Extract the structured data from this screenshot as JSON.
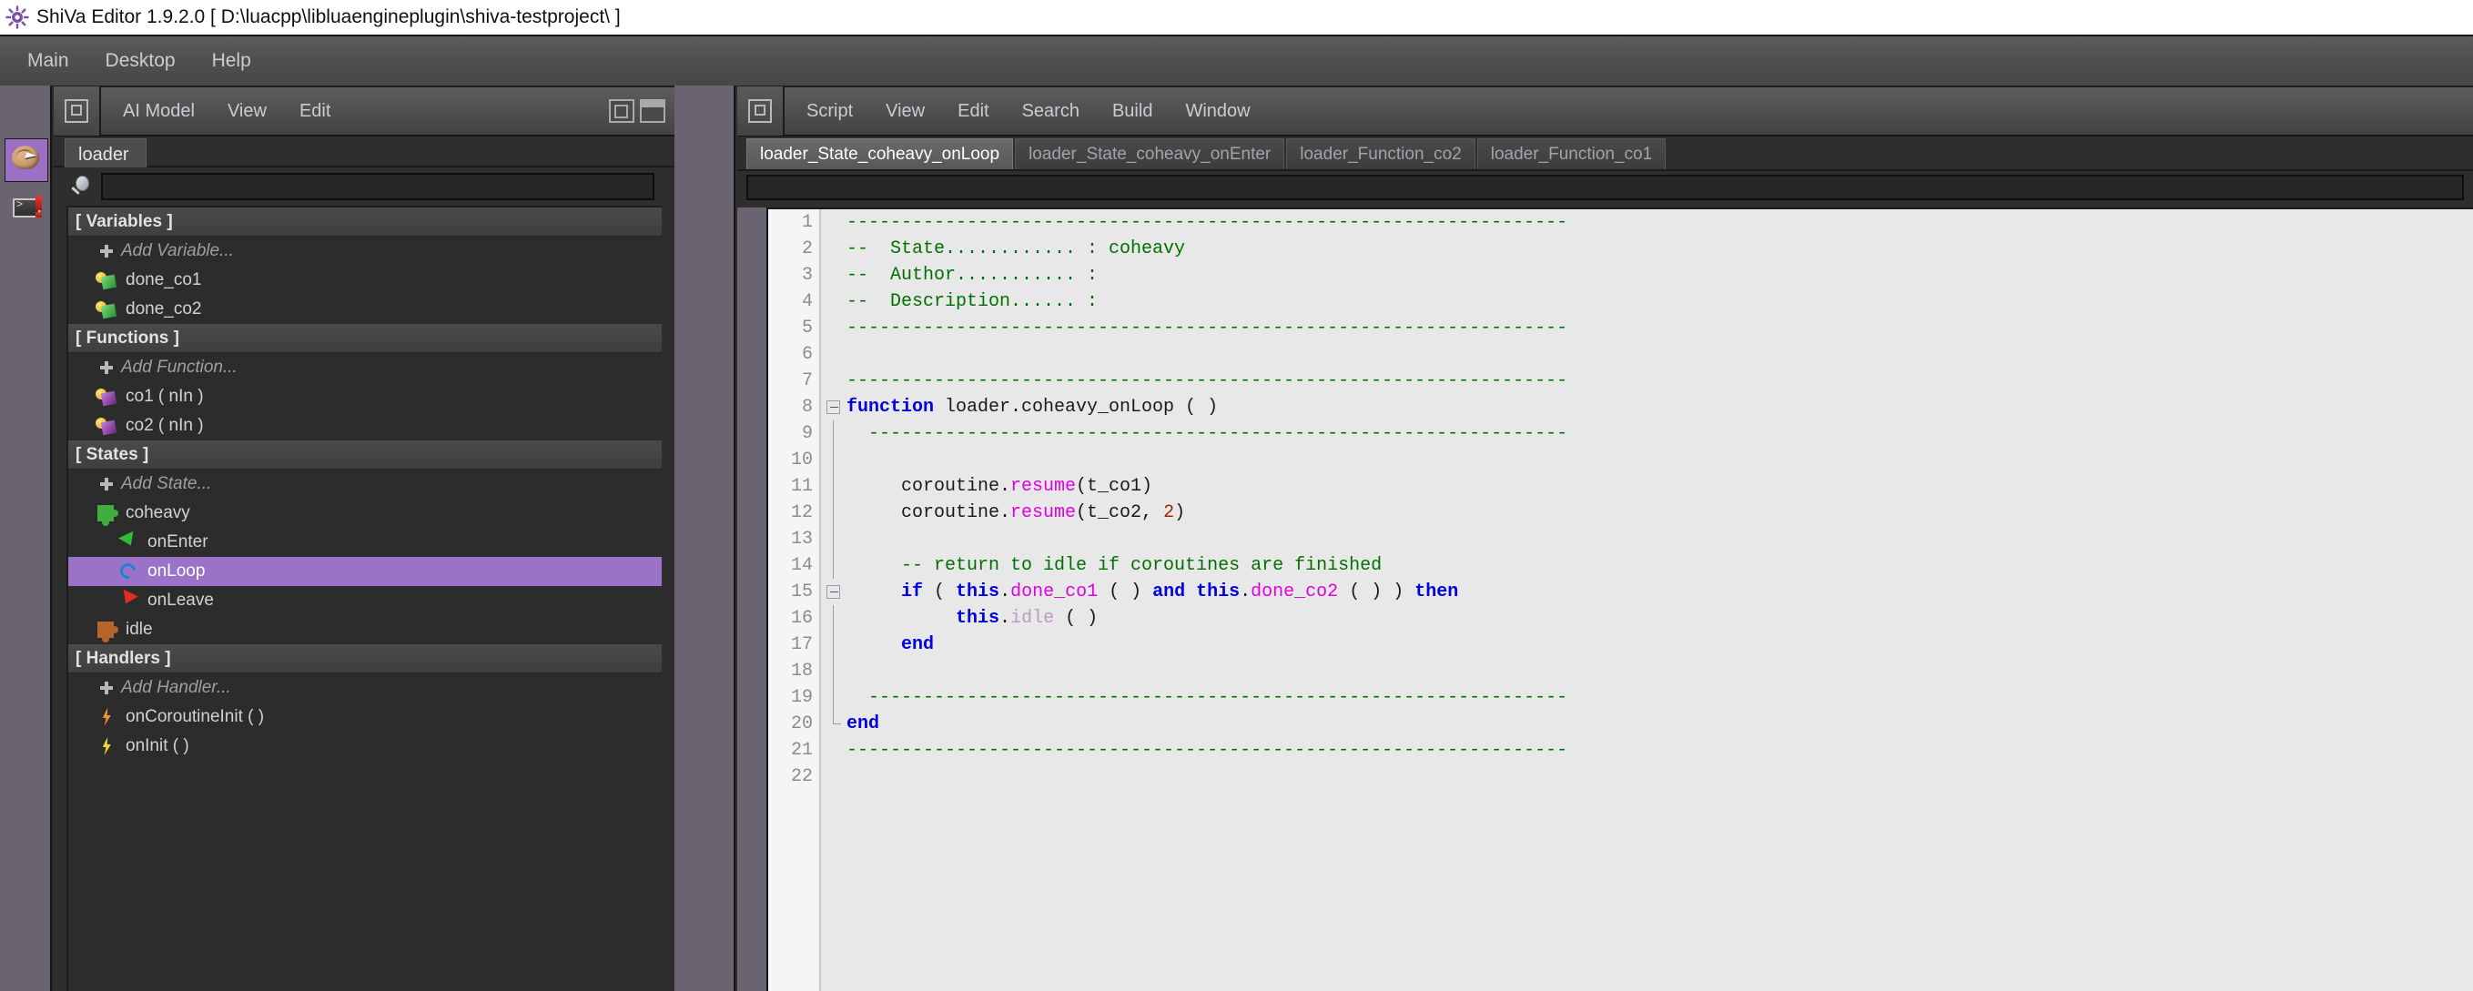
{
  "window": {
    "title": "ShiVa Editor 1.9.2.0 [ D:\\luacpp\\libluaengineplugin\\shiva-testproject\\ ]",
    "app_icon": "shiva-sun-icon"
  },
  "menubar": {
    "items": [
      {
        "label": "Main"
      },
      {
        "label": "Desktop"
      },
      {
        "label": "Help"
      }
    ]
  },
  "iconstrip": {
    "buttons": [
      {
        "name": "ai-model-button",
        "icon": "brain-cursor-icon",
        "active": true
      },
      {
        "name": "log-console-button",
        "icon": "console-alert-icon",
        "active": false
      }
    ]
  },
  "left_panel": {
    "toolbar": {
      "dock_icon": "dock-panel-icon",
      "items": [
        {
          "label": "AI Model"
        },
        {
          "label": "View"
        },
        {
          "label": "Edit"
        }
      ]
    },
    "tab": {
      "label": "loader"
    },
    "search": {
      "value": "",
      "placeholder": "",
      "icon": "magnifier-icon"
    },
    "tree": [
      {
        "type": "section",
        "label": "[ Variables ]"
      },
      {
        "type": "add",
        "label": "Add Variable...",
        "icon": "plus-icon",
        "indent": 1
      },
      {
        "type": "item",
        "label": "done_co1",
        "icon": "key-green-icon",
        "indent": 1
      },
      {
        "type": "item",
        "label": "done_co2",
        "icon": "key-green-icon",
        "indent": 1
      },
      {
        "type": "section",
        "label": "[ Functions ]"
      },
      {
        "type": "add",
        "label": "Add Function...",
        "icon": "plus-icon",
        "indent": 1
      },
      {
        "type": "item",
        "label": "co1 ( nIn )",
        "icon": "key-purple-icon",
        "indent": 1
      },
      {
        "type": "item",
        "label": "co2 ( nIn )",
        "icon": "key-purple-icon",
        "indent": 1
      },
      {
        "type": "section",
        "label": "[ States ]"
      },
      {
        "type": "add",
        "label": "Add State...",
        "icon": "plus-icon",
        "indent": 1
      },
      {
        "type": "item",
        "label": "coheavy",
        "icon": "puzzle-green-icon",
        "indent": 1
      },
      {
        "type": "item",
        "label": "onEnter",
        "icon": "arrow-enter-icon",
        "indent": 2
      },
      {
        "type": "item",
        "label": "onLoop",
        "icon": "loop-icon",
        "indent": 2,
        "selected": true
      },
      {
        "type": "item",
        "label": "onLeave",
        "icon": "arrow-leave-icon",
        "indent": 2
      },
      {
        "type": "item",
        "label": "idle",
        "icon": "puzzle-brown-icon",
        "indent": 1
      },
      {
        "type": "section",
        "label": "[ Handlers ]"
      },
      {
        "type": "add",
        "label": "Add Handler...",
        "icon": "plus-icon",
        "indent": 1
      },
      {
        "type": "item",
        "label": "onCoroutineInit ( )",
        "icon": "bolt-orange-icon",
        "indent": 1
      },
      {
        "type": "item",
        "label": "onInit ( )",
        "icon": "bolt-yellow-icon",
        "indent": 1
      }
    ]
  },
  "right_panel": {
    "toolbar": {
      "dock_icon": "dock-panel-icon",
      "items": [
        {
          "label": "Script"
        },
        {
          "label": "View"
        },
        {
          "label": "Edit"
        },
        {
          "label": "Search"
        },
        {
          "label": "Build"
        },
        {
          "label": "Window"
        }
      ]
    },
    "tabs": [
      {
        "label": "loader_State_coheavy_onLoop",
        "active": true
      },
      {
        "label": "loader_State_coheavy_onEnter",
        "active": false
      },
      {
        "label": "loader_Function_co2",
        "active": false
      },
      {
        "label": "loader_Function_co1",
        "active": false
      }
    ],
    "search": {
      "value": "",
      "placeholder": ""
    },
    "editor": {
      "selected_color": "#9a73c8",
      "comment_color": "#007000",
      "keyword_color": "#0000e0",
      "call_color": "#e000e0",
      "number_color": "#aa2200",
      "caret_line": 19,
      "lines": [
        {
          "n": 1,
          "fold": "none",
          "tokens": [
            {
              "t": "com",
              "s": "------------------------------------------------------------------"
            }
          ]
        },
        {
          "n": 2,
          "fold": "none",
          "tokens": [
            {
              "t": "com",
              "s": "--  State............ : coheavy"
            }
          ]
        },
        {
          "n": 3,
          "fold": "none",
          "tokens": [
            {
              "t": "com",
              "s": "--  Author........... :"
            }
          ]
        },
        {
          "n": 4,
          "fold": "none",
          "tokens": [
            {
              "t": "com",
              "s": "--  Description...... :"
            }
          ]
        },
        {
          "n": 5,
          "fold": "none",
          "tokens": [
            {
              "t": "com",
              "s": "------------------------------------------------------------------"
            }
          ]
        },
        {
          "n": 6,
          "fold": "none",
          "tokens": []
        },
        {
          "n": 7,
          "fold": "none",
          "tokens": [
            {
              "t": "com",
              "s": "------------------------------------------------------------------"
            }
          ]
        },
        {
          "n": 8,
          "fold": "box",
          "tokens": [
            {
              "t": "kw",
              "s": "function"
            },
            {
              "t": "plain",
              "s": " loader.coheavy_onLoop ( )"
            }
          ]
        },
        {
          "n": 9,
          "fold": "line",
          "tokens": [
            {
              "t": "com",
              "s": "  ----------------------------------------------------------------"
            }
          ]
        },
        {
          "n": 10,
          "fold": "line",
          "tokens": []
        },
        {
          "n": 11,
          "fold": "line",
          "tokens": [
            {
              "t": "plain",
              "s": "     coroutine."
            },
            {
              "t": "call",
              "s": "resume"
            },
            {
              "t": "plain",
              "s": "(t_co1)"
            }
          ]
        },
        {
          "n": 12,
          "fold": "line",
          "tokens": [
            {
              "t": "plain",
              "s": "     coroutine."
            },
            {
              "t": "call",
              "s": "resume"
            },
            {
              "t": "plain",
              "s": "(t_co2, "
            },
            {
              "t": "num",
              "s": "2"
            },
            {
              "t": "plain",
              "s": ")"
            }
          ]
        },
        {
          "n": 13,
          "fold": "line",
          "tokens": []
        },
        {
          "n": 14,
          "fold": "line",
          "tokens": [
            {
              "t": "com",
              "s": "     -- return to idle if coroutines are finished"
            }
          ]
        },
        {
          "n": 15,
          "fold": "box",
          "tokens": [
            {
              "t": "plain",
              "s": "     "
            },
            {
              "t": "kw",
              "s": "if"
            },
            {
              "t": "plain",
              "s": " ( "
            },
            {
              "t": "kw",
              "s": "this"
            },
            {
              "t": "plain",
              "s": "."
            },
            {
              "t": "call",
              "s": "done_co1"
            },
            {
              "t": "plain",
              "s": " ( ) "
            },
            {
              "t": "kw",
              "s": "and"
            },
            {
              "t": "plain",
              "s": " "
            },
            {
              "t": "kw",
              "s": "this"
            },
            {
              "t": "plain",
              "s": "."
            },
            {
              "t": "call",
              "s": "done_co2"
            },
            {
              "t": "plain",
              "s": " ( ) ) "
            },
            {
              "t": "kw",
              "s": "then"
            }
          ]
        },
        {
          "n": 16,
          "fold": "line",
          "tokens": [
            {
              "t": "plain",
              "s": "          "
            },
            {
              "t": "kw",
              "s": "this"
            },
            {
              "t": "plain",
              "s": "."
            },
            {
              "t": "dim",
              "s": "idle"
            },
            {
              "t": "plain",
              "s": " ( )"
            }
          ]
        },
        {
          "n": 17,
          "fold": "line",
          "tokens": [
            {
              "t": "plain",
              "s": "     "
            },
            {
              "t": "kw",
              "s": "end"
            }
          ]
        },
        {
          "n": 18,
          "fold": "tick",
          "tokens": []
        },
        {
          "n": 19,
          "fold": "line",
          "tokens": [
            {
              "t": "com",
              "s": "  ----------------------------------------------------------------"
            }
          ]
        },
        {
          "n": 20,
          "fold": "end",
          "tokens": [
            {
              "t": "kw",
              "s": "end"
            }
          ]
        },
        {
          "n": 21,
          "fold": "none",
          "tokens": [
            {
              "t": "com",
              "s": "------------------------------------------------------------------"
            }
          ]
        },
        {
          "n": 22,
          "fold": "none",
          "tokens": []
        }
      ]
    }
  }
}
